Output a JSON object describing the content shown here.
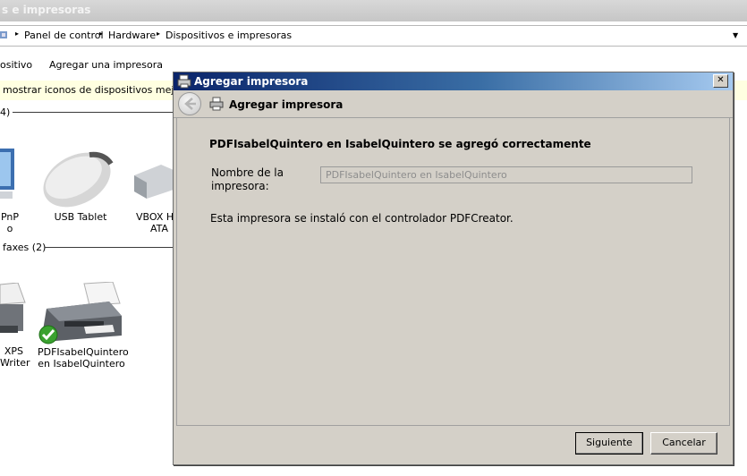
{
  "window": {
    "title": "s e impresoras"
  },
  "breadcrumb": {
    "items": [
      "Panel de control",
      "Hardware",
      "Dispositivos e impresoras"
    ]
  },
  "toolbar": {
    "items": [
      "ositivo",
      "Agregar una impresora"
    ]
  },
  "infobar": {
    "text": "mostrar iconos de dispositivos mejorado"
  },
  "groups": {
    "devices": {
      "label": "4)"
    },
    "printers": {
      "label": "faxes (2)"
    }
  },
  "devices": [
    {
      "label_lines": [
        "PnP",
        "o"
      ]
    },
    {
      "label_lines": [
        "USB Tablet"
      ]
    },
    {
      "label_lines": [
        "VBOX H",
        "ATA"
      ]
    }
  ],
  "printers": [
    {
      "label_lines": [
        "XPS",
        "Writer"
      ]
    },
    {
      "label_lines": [
        "PDFIsabelQuintero",
        "en IsabelQuintero"
      ]
    }
  ],
  "dialog": {
    "title": "Agregar impresora",
    "close_label": "✕",
    "heading": "Agregar impresora",
    "success_message": "PDFIsabelQuintero en IsabelQuintero se agregó correctamente",
    "name_label_line1": "Nombre de la",
    "name_label_line2": "impresora:",
    "name_value": "PDFIsabelQuintero en IsabelQuintero",
    "driver_message": "Esta impresora se instaló con el controlador PDFCreator.",
    "next_label": "Siguiente",
    "cancel_label": "Cancelar"
  }
}
